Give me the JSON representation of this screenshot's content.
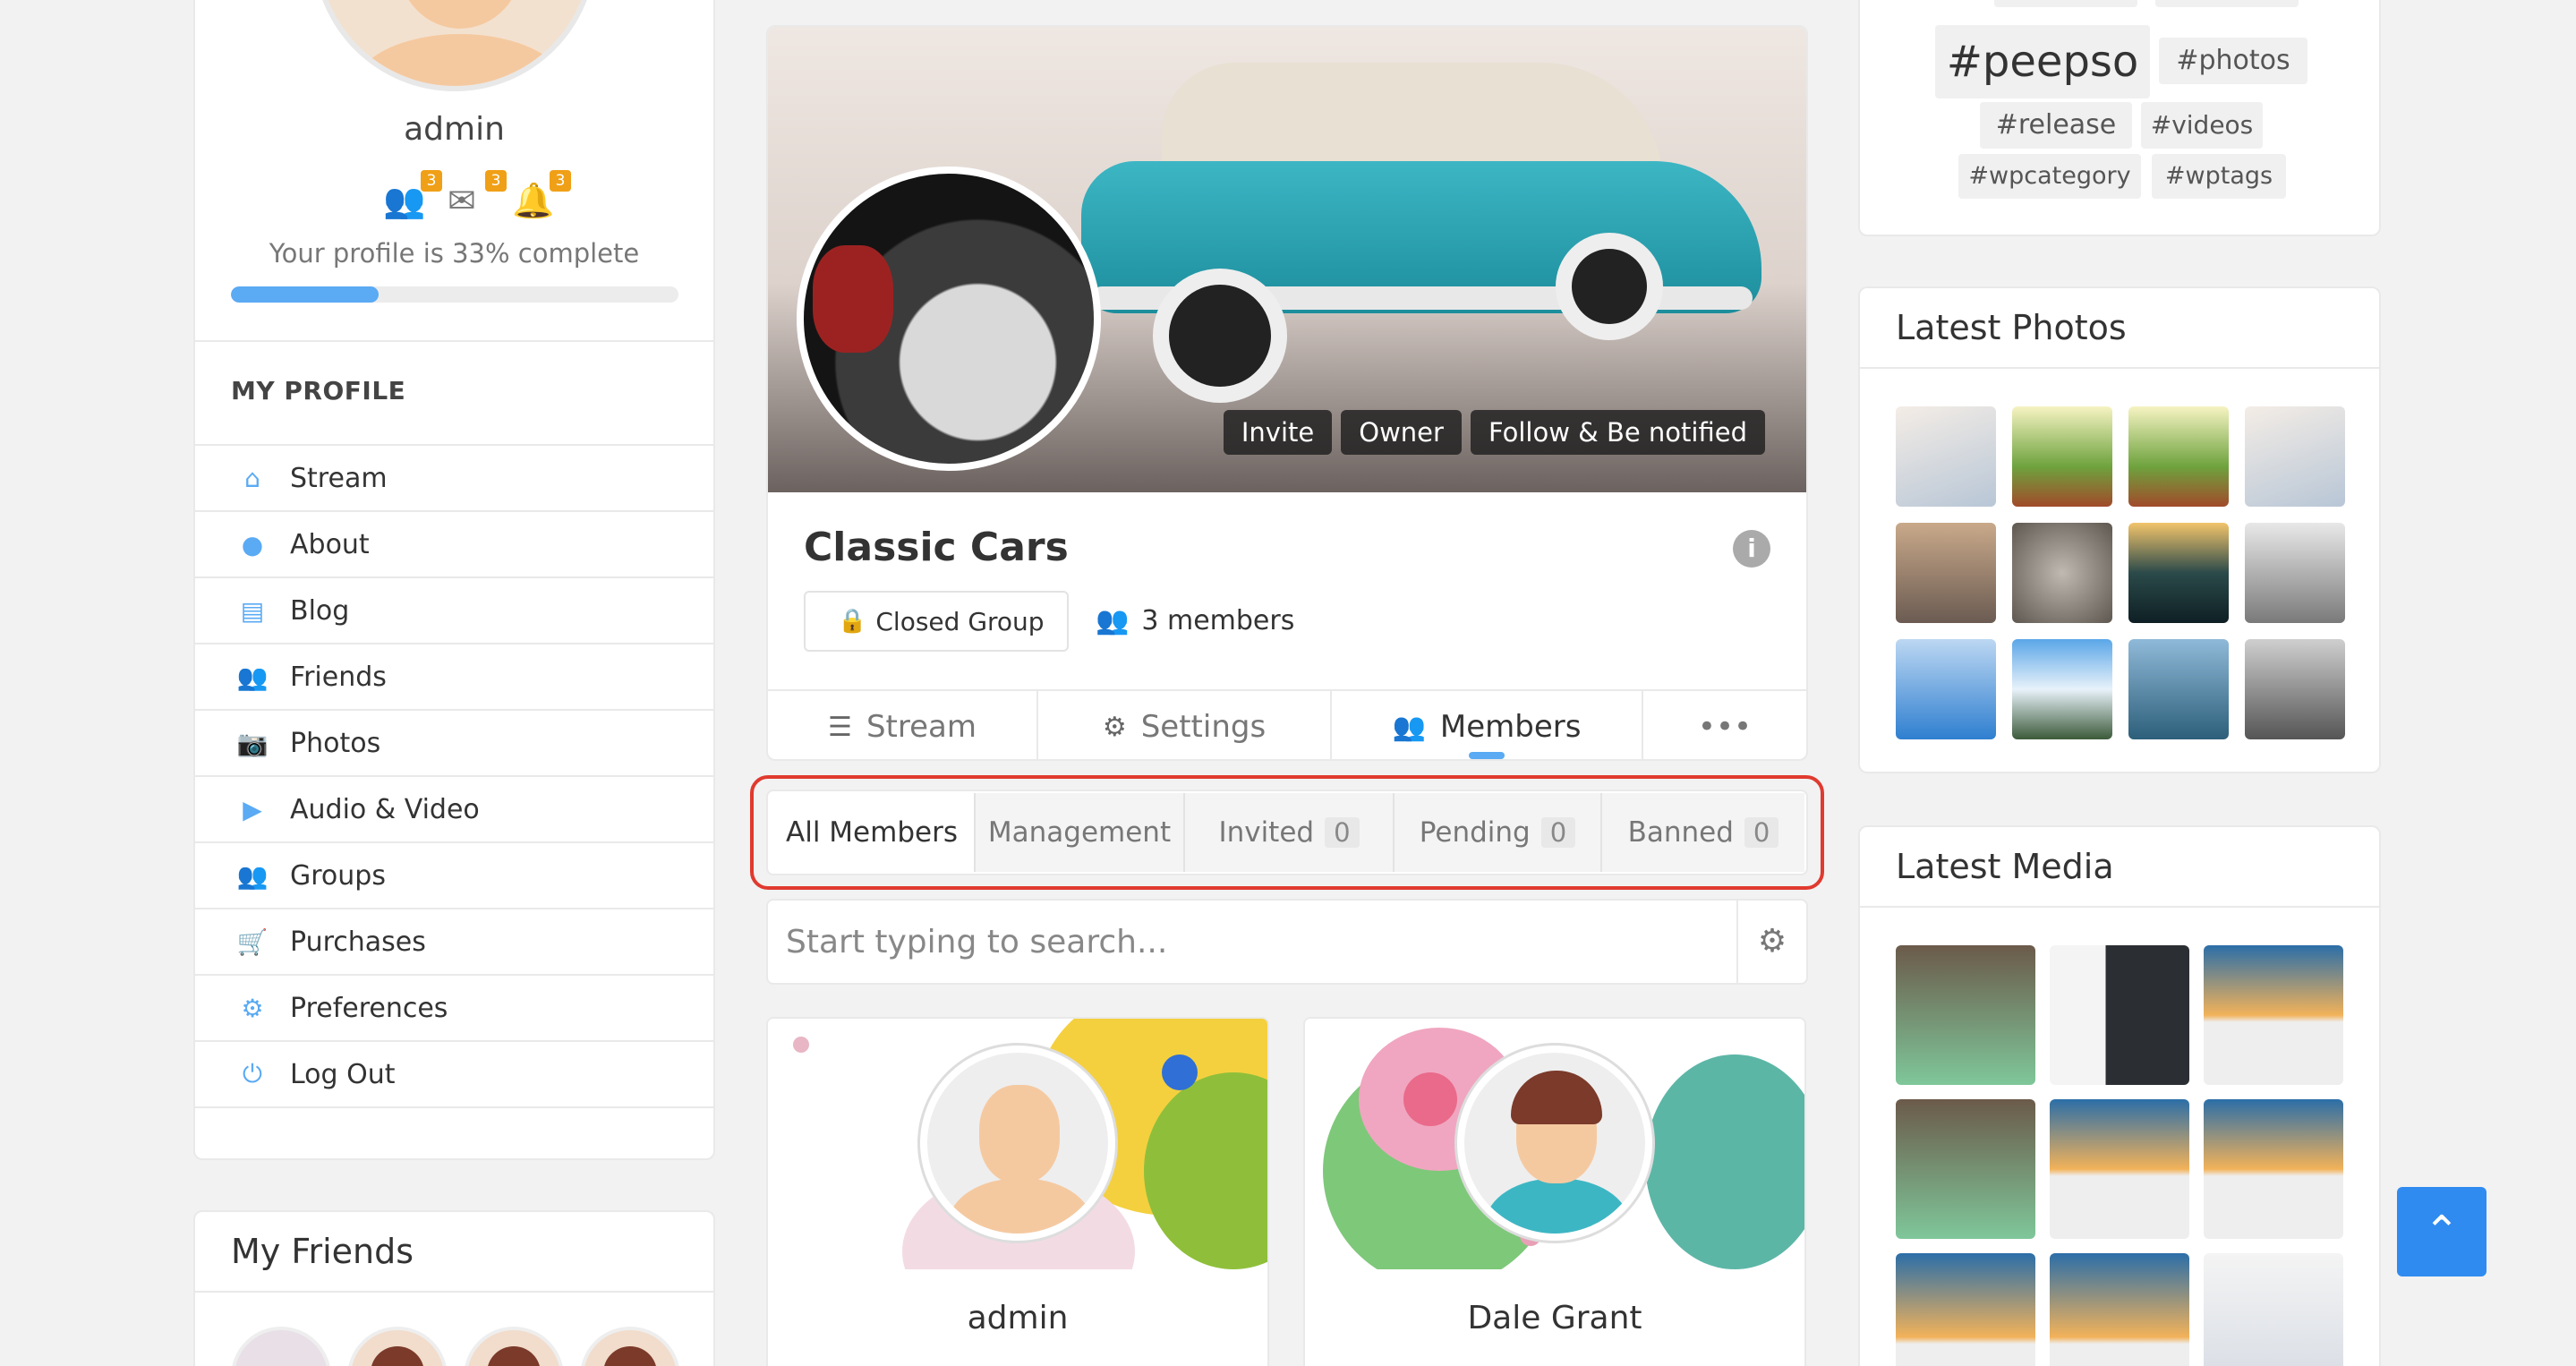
{
  "profile": {
    "name": "admin",
    "notifications": [
      {
        "icon": "friends-icon",
        "count": "3"
      },
      {
        "icon": "messages-icon",
        "count": "3"
      },
      {
        "icon": "bell-icon",
        "count": "3"
      }
    ],
    "completeness_text": "Your profile is 33% complete",
    "completeness_value": 0.33,
    "section_title": "MY PROFILE",
    "menu": [
      {
        "label": "Stream",
        "icon": "home-icon"
      },
      {
        "label": "About",
        "icon": "user-icon"
      },
      {
        "label": "Blog",
        "icon": "blog-icon"
      },
      {
        "label": "Friends",
        "icon": "friends-icon"
      },
      {
        "label": "Photos",
        "icon": "camera-icon"
      },
      {
        "label": "Audio & Video",
        "icon": "video-icon"
      },
      {
        "label": "Groups",
        "icon": "groups-icon"
      },
      {
        "label": "Purchases",
        "icon": "cart-icon"
      },
      {
        "label": "Preferences",
        "icon": "gear-icon"
      },
      {
        "label": "Log Out",
        "icon": "power-icon"
      }
    ]
  },
  "friends_widget": {
    "title": "My Friends"
  },
  "group": {
    "name": "Classic Cars",
    "actions": [
      "Invite",
      "Owner",
      "Follow & Be notified"
    ],
    "privacy": "Closed Group",
    "members_count": "3 members",
    "tabs": [
      {
        "label": "Stream",
        "icon": "list-icon"
      },
      {
        "label": "Settings",
        "icon": "gear-icon"
      },
      {
        "label": "Members",
        "icon": "members-icon",
        "active": true
      },
      {
        "label": "",
        "icon": "more-icon"
      }
    ],
    "more_glyph": "•••"
  },
  "member_tabs": [
    {
      "label": "All Members",
      "count": null,
      "active": true
    },
    {
      "label": "Management",
      "count": null
    },
    {
      "label": "Invited",
      "count": "0"
    },
    {
      "label": "Pending",
      "count": "0"
    },
    {
      "label": "Banned",
      "count": "0"
    }
  ],
  "search": {
    "placeholder": "Start typing to search..."
  },
  "members": [
    {
      "name": "admin"
    },
    {
      "name": "Dale Grant"
    }
  ],
  "tags_widget": {
    "tags": [
      "#peepso",
      "#photos",
      "#release",
      "#videos",
      "#wpcategory",
      "#wptags"
    ]
  },
  "photos_widget": {
    "title": "Latest Photos"
  },
  "media_widget": {
    "title": "Latest Media"
  },
  "colors": {
    "accent": "#5aaaf4",
    "badge": "#f0a017",
    "highlight": "#e03a2f",
    "scroll_button": "#2f8bf0"
  }
}
